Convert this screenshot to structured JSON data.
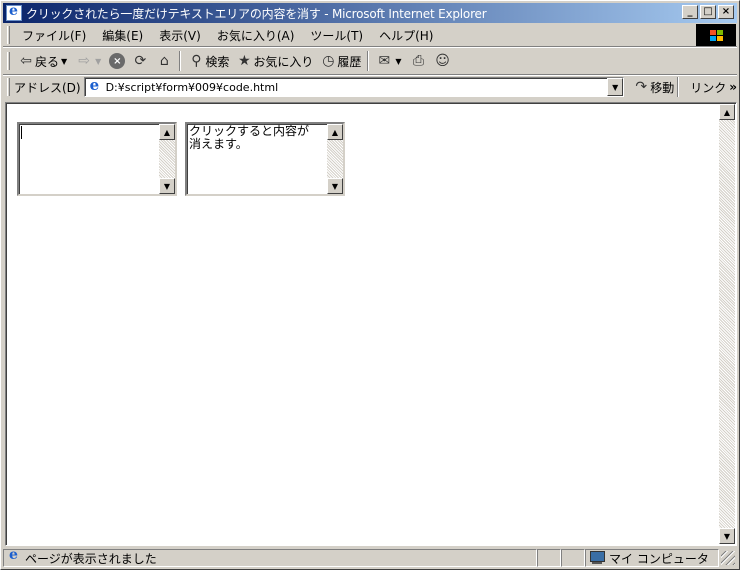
{
  "window": {
    "title": "クリックされたら一度だけテキストエリアの内容を消す - Microsoft Internet Explorer",
    "controls": {
      "minimize": "_",
      "maximize": "□",
      "close": "×"
    }
  },
  "menu": [
    "ファイル(F)",
    "編集(E)",
    "表示(V)",
    "お気に入り(A)",
    "ツール(T)",
    "ヘルプ(H)"
  ],
  "toolbar": {
    "back": "戻る",
    "search": "検索",
    "favorites": "お気に入り",
    "history": "履歴"
  },
  "address": {
    "label": "アドレス(D)",
    "url": "D:¥script¥form¥009¥code.html",
    "go": "移動",
    "links": "リンク",
    "links_more": "»"
  },
  "page": {
    "textarea1": {
      "text": ""
    },
    "textarea2": {
      "text": "クリックすると内容が\n消えます。"
    }
  },
  "status": {
    "message": "ページが表示されました",
    "zone": "マイ コンピュータ"
  },
  "colors": {
    "titlebar_start": "#0a246a",
    "titlebar_end": "#a6caf0",
    "chrome": "#d4d0c8"
  }
}
